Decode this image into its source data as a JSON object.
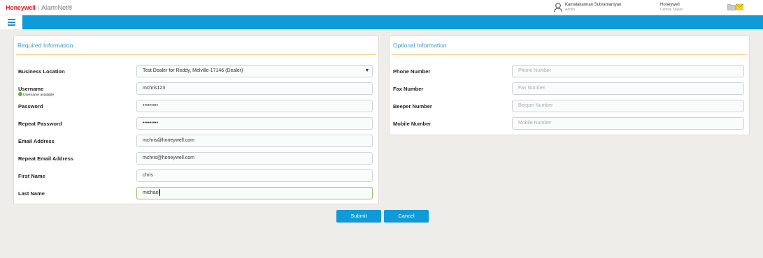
{
  "header": {
    "brand": "Honeywell",
    "separator": "|",
    "product": "AlarmNet®",
    "user_name": "Kamalakannan Subramaniyan",
    "user_role": "Admin",
    "company_name": "Honeywell",
    "company_type": "Central Station",
    "icons": [
      "user-icon",
      "folder-icon",
      "mail-icon"
    ]
  },
  "nav": {
    "menu_icon": "hamburger-menu-icon"
  },
  "required": {
    "title": "Required Information",
    "business_location": {
      "label": "Business Location",
      "value": "Test Dealer for Reddy, Melville-17146 (Dealer)"
    },
    "username": {
      "label": "Username",
      "value": "mchris123",
      "status": "Username available"
    },
    "password": {
      "label": "Password",
      "value": "•••••••••"
    },
    "repeat_password": {
      "label": "Repeat Password",
      "value": "•••••••••"
    },
    "email": {
      "label": "Email Address",
      "value": "mchris@honeywell.com"
    },
    "repeat_email": {
      "label": "Repeat Email Address",
      "value": "mchris@honeywell.com"
    },
    "first_name": {
      "label": "First Name",
      "value": "chris"
    },
    "last_name": {
      "label": "Last Name",
      "value": "michael"
    }
  },
  "optional": {
    "title": "Optional Information",
    "phone": {
      "label": "Phone Number",
      "placeholder": "Phone Number"
    },
    "fax": {
      "label": "Fax Number",
      "placeholder": "Fax Number"
    },
    "beeper": {
      "label": "Beeper Number",
      "placeholder": "Beeper Number"
    },
    "mobile": {
      "label": "Mobile Number",
      "placeholder": "Mobile Number"
    }
  },
  "actions": {
    "submit": "Submit",
    "cancel": "Cancel"
  },
  "colors": {
    "accent": "#0f9bd9",
    "brand_red": "#e4202e",
    "title_blue": "#3a9bd2",
    "rule_orange": "#f1c97e"
  }
}
